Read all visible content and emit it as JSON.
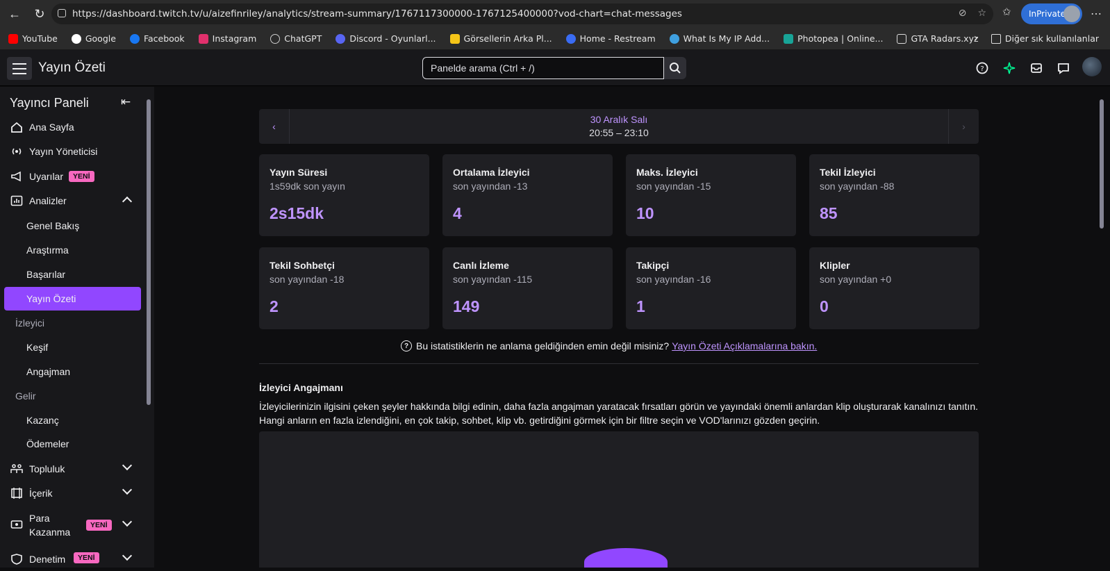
{
  "browser": {
    "url": "https://dashboard.twitch.tv/u/aizefinriley/analytics/stream-summary/1767117300000-1767125400000?vod-chart=chat-messages",
    "inprivate_label": "InPrivate",
    "bookmarks": [
      {
        "label": "YouTube",
        "color": "#ff0000"
      },
      {
        "label": "Google",
        "color": "#ffffff"
      },
      {
        "label": "Facebook",
        "color": "#1877f2"
      },
      {
        "label": "Instagram",
        "color": "#e1306c"
      },
      {
        "label": "ChatGPT",
        "color": "#cccccc"
      },
      {
        "label": "Discord - Oyunlarl...",
        "color": "#5865f2"
      },
      {
        "label": "Görsellerin Arka Pl...",
        "color": "#f5c518"
      },
      {
        "label": "Home - Restream",
        "color": "#3a6cf4"
      },
      {
        "label": "What Is My IP Add...",
        "color": "#3fa0e0"
      },
      {
        "label": "Photopea | Online...",
        "color": "#18a497"
      },
      {
        "label": "GTA Radars.xyz",
        "color": "#dddddd"
      }
    ],
    "other_bookmarks": "Diğer sık kullanılanlar"
  },
  "header": {
    "title": "Yayın Özeti",
    "search_placeholder": "Panelde arama (Ctrl + /)"
  },
  "sidebar": {
    "title": "Yayıncı Paneli",
    "items": {
      "home": "Ana Sayfa",
      "stream_manager": "Yayın Yöneticisi",
      "alerts": "Uyarılar",
      "analytics": "Analizler",
      "overview": "Genel Bakış",
      "research": "Araştırma",
      "achievements": "Başarılar",
      "stream_summary": "Yayın Özeti",
      "viewer_section": "İzleyici",
      "discovery": "Keşif",
      "engagement": "Angajman",
      "revenue_section": "Gelir",
      "earnings": "Kazanç",
      "payouts": "Ödemeler",
      "community": "Topluluk",
      "content": "İçerik",
      "monetization": "Para Kazanma",
      "moderation": "Denetim"
    },
    "new_badge": "YENİ"
  },
  "date_nav": {
    "date": "30 Aralık Salı",
    "time": "20:55 – 23:10"
  },
  "stats": [
    {
      "title": "Yayın Süresi",
      "sub": "1s59dk son yayın",
      "value": "2s15dk"
    },
    {
      "title": "Ortalama İzleyici",
      "sub": "son yayından -13",
      "value": "4"
    },
    {
      "title": "Maks. İzleyici",
      "sub": "son yayından -15",
      "value": "10"
    },
    {
      "title": "Tekil İzleyici",
      "sub": "son yayından -88",
      "value": "85"
    },
    {
      "title": "Tekil Sohbetçi",
      "sub": "son yayından -18",
      "value": "2"
    },
    {
      "title": "Canlı İzleme",
      "sub": "son yayından -115",
      "value": "149"
    },
    {
      "title": "Takipçi",
      "sub": "son yayından -16",
      "value": "1"
    },
    {
      "title": "Klipler",
      "sub": "son yayından +0",
      "value": "0"
    }
  ],
  "help": {
    "text": "Bu istatistiklerin ne anlama geldiğinden emin değil misiniz?",
    "link": "Yayın Özeti Açıklamalarına bakın."
  },
  "engagement": {
    "title": "İzleyici Angajmanı",
    "description": "İzleyicilerinizin ilgisini çeken şeyler hakkında bilgi edinin, daha fazla angajman yaratacak fırsatları görün ve yayındaki önemli anlardan klip oluşturarak kanalınızı tanıtın. Hangi anların en fazla izlendiğini, en çok takip, sohbet, klip vb. getirdiğini görmek için bir filtre seçin ve VOD'larınızı gözden geçirin."
  }
}
